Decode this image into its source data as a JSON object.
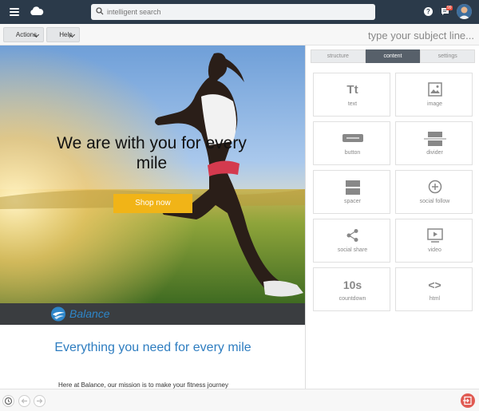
{
  "topbar": {
    "search_placeholder": "intelligent search",
    "icons": [
      "menu-icon",
      "cloud-icon",
      "search-icon",
      "help-icon",
      "messages-icon",
      "avatar"
    ],
    "messages_badge": "99"
  },
  "toolbar": {
    "actions_label": "Actions",
    "help_label": "Help",
    "subject_placeholder": "type your subject line..."
  },
  "preview": {
    "hero_title": "We are with you for every mile",
    "shop_button": "Shop now",
    "brand_name": "Balance",
    "tagline": "Everything you need for every mile",
    "body_text": "Here at Balance, our mission is to make your fitness journey"
  },
  "panel": {
    "tabs": [
      "structure",
      "content",
      "settings"
    ],
    "active_tab": "content",
    "tiles": [
      {
        "label": "text",
        "icon": "text-icon",
        "icon_text": "Tt"
      },
      {
        "label": "image",
        "icon": "image-icon"
      },
      {
        "label": "button",
        "icon": "button-icon"
      },
      {
        "label": "divider",
        "icon": "divider-icon"
      },
      {
        "label": "spacer",
        "icon": "spacer-icon"
      },
      {
        "label": "social follow",
        "icon": "plus-circle-icon"
      },
      {
        "label": "social share",
        "icon": "share-icon"
      },
      {
        "label": "video",
        "icon": "video-icon"
      },
      {
        "label": "countdown",
        "icon": "countdown-icon",
        "icon_text": "10s"
      },
      {
        "label": "html",
        "icon": "code-icon",
        "icon_text": "<>"
      }
    ]
  },
  "bottombar": {
    "icons": [
      "history-icon",
      "undo-icon",
      "redo-icon",
      "exit-icon"
    ]
  },
  "colors": {
    "topbar_bg": "#2b3a4a",
    "accent_blue": "#2e7dc0",
    "shop_button": "#f1b417",
    "active_tab": "#57606a",
    "exit_button": "#e05a52"
  }
}
